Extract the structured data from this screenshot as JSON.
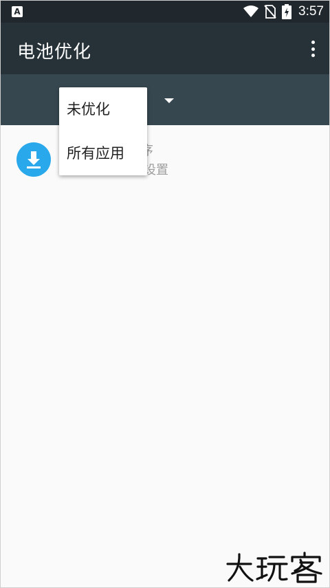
{
  "status_bar": {
    "time": "3:57",
    "notification_icon": "a-app-icon",
    "icons": [
      "wifi-icon",
      "no-sim-icon",
      "battery-charging-icon"
    ]
  },
  "app_bar": {
    "title": "电池优化",
    "more_icon": "more-vert-icon"
  },
  "filter_bar": {
    "dropdown_icon": "arrow-drop-down-icon"
  },
  "list": {
    "items": [
      {
        "icon": "download-icon",
        "title_partial": "序",
        "subtitle_partial": "设置"
      }
    ]
  },
  "popup_menu": {
    "options": [
      "未优化",
      "所有应用"
    ]
  },
  "watermark": {
    "text": "大玩客"
  },
  "colors": {
    "status_bar": "#20282d",
    "app_bar": "#263238",
    "filter_bar": "#37474f",
    "accent_icon": "#29a8eb",
    "background": "#fafafa"
  }
}
